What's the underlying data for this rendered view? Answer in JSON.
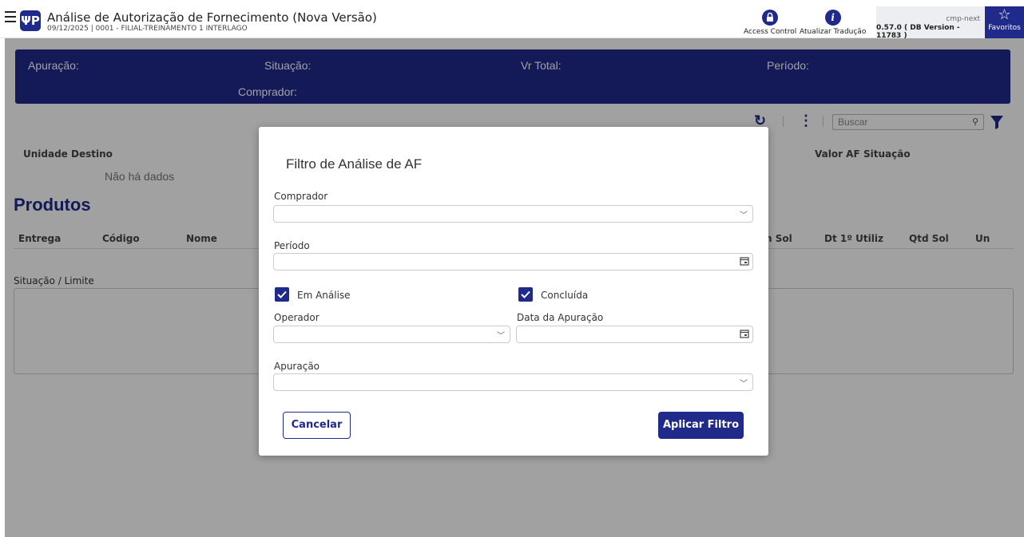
{
  "app": {
    "title": "Análise de Autorização de Fornecimento (Nova Versão)",
    "subtitle": "09/12/2025 | 0001 - FILIAL-TREINAMENTO 1 INTERLAGO",
    "logo_glyph": "ΨΡ"
  },
  "topbar": {
    "access_control": "Access Control",
    "atualizar_traducao": "Atualizar Tradução",
    "env": "cmp-next",
    "version": "0.57.0 ( DB Version - 11783 )",
    "favoritos": "Favoritos",
    "brand_color": "#1f2a8a"
  },
  "header_card": {
    "apuracao": "Apuração:",
    "situacao": "Situação:",
    "vr_total": "Vr Total:",
    "periodo": "Período:",
    "comprador": "Comprador:"
  },
  "toolbar": {
    "search_placeholder": "Buscar"
  },
  "grid_top": {
    "columns": [
      "Unidade Destino",
      "Valor AF",
      "Situação"
    ],
    "empty": "Não há dados"
  },
  "produtos": {
    "title": "Produtos",
    "columns": [
      "Entrega",
      "Código",
      "Nome",
      "n Sol",
      "Dt 1º Utiliz",
      "Qtd Sol",
      "Un"
    ]
  },
  "situacao_limite": {
    "label": "Situação / Limite"
  },
  "modal": {
    "title": "Filtro de Análise de AF",
    "comprador_label": "Comprador",
    "comprador_value": "",
    "periodo_label": "Período",
    "periodo_value": "",
    "em_analise_label": "Em Análise",
    "em_analise_checked": true,
    "concluida_label": "Concluída",
    "concluida_checked": true,
    "operador_label": "Operador",
    "operador_value": "",
    "data_apuracao_label": "Data da Apuração",
    "data_apuracao_value": "",
    "apuracao_label": "Apuração",
    "apuracao_value": "",
    "cancel_label": "Cancelar",
    "apply_label": "Aplicar Filtro"
  }
}
